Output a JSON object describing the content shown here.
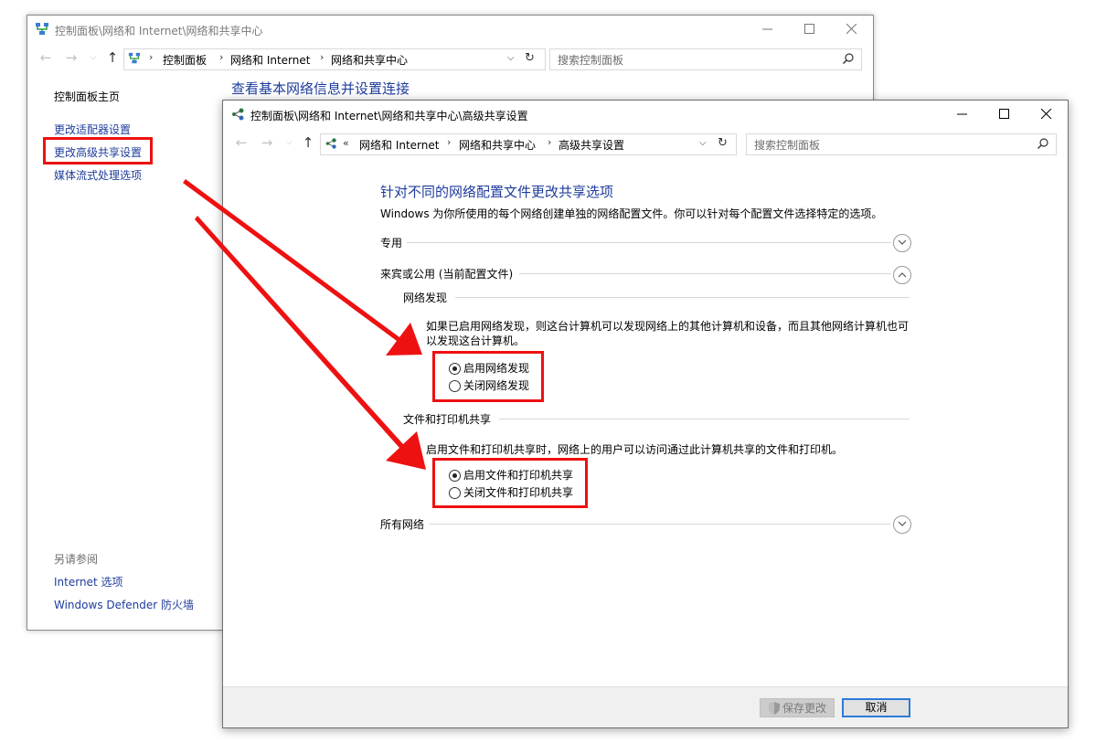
{
  "back_window": {
    "title": "控制面板\\网络和 Internet\\网络和共享中心",
    "breadcrumb": [
      "控制面板",
      "网络和 Internet",
      "网络和共享中心"
    ],
    "search_placeholder": "搜索控制面板",
    "sidebar": {
      "home": "控制面板主页",
      "items": [
        "更改适配器设置",
        "更改高级共享设置",
        "媒体流式处理选项"
      ],
      "see_also_label": "另请参阅",
      "see_also": [
        "Internet 选项",
        "Windows Defender 防火墙"
      ]
    },
    "main_heading": "查看基本网络信息并设置连接"
  },
  "front_window": {
    "title": "控制面板\\网络和 Internet\\网络和共享中心\\高级共享设置",
    "breadcrumb_prefix": "«",
    "breadcrumb": [
      "网络和 Internet",
      "网络和共享中心",
      "高级共享设置"
    ],
    "search_placeholder": "搜索控制面板",
    "heading": "针对不同的网络配置文件更改共享选项",
    "description": "Windows 为你所使用的每个网络创建单独的网络配置文件。你可以针对每个配置文件选择特定的选项。",
    "profiles": {
      "private": "专用",
      "guest_public": "来宾或公用 (当前配置文件)",
      "all_networks": "所有网络"
    },
    "network_discovery": {
      "title": "网络发现",
      "description": "如果已启用网络发现，则这台计算机可以发现网络上的其他计算机和设备，而且其他网络计算机也可以发现这台计算机。",
      "options": [
        "启用网络发现",
        "关闭网络发现"
      ],
      "selected": 0
    },
    "file_printer_sharing": {
      "title": "文件和打印机共享",
      "description": "启用文件和打印机共享时，网络上的用户可以访问通过此计算机共享的文件和打印机。",
      "options": [
        "启用文件和打印机共享",
        "关闭文件和打印机共享"
      ],
      "selected": 0
    },
    "footer": {
      "save_label": "保存更改",
      "cancel_label": "取消"
    }
  },
  "colors": {
    "highlight_box": "#ee1111",
    "link_blue": "#1e3c9c",
    "cancel_focus": "#2a7bd8"
  }
}
